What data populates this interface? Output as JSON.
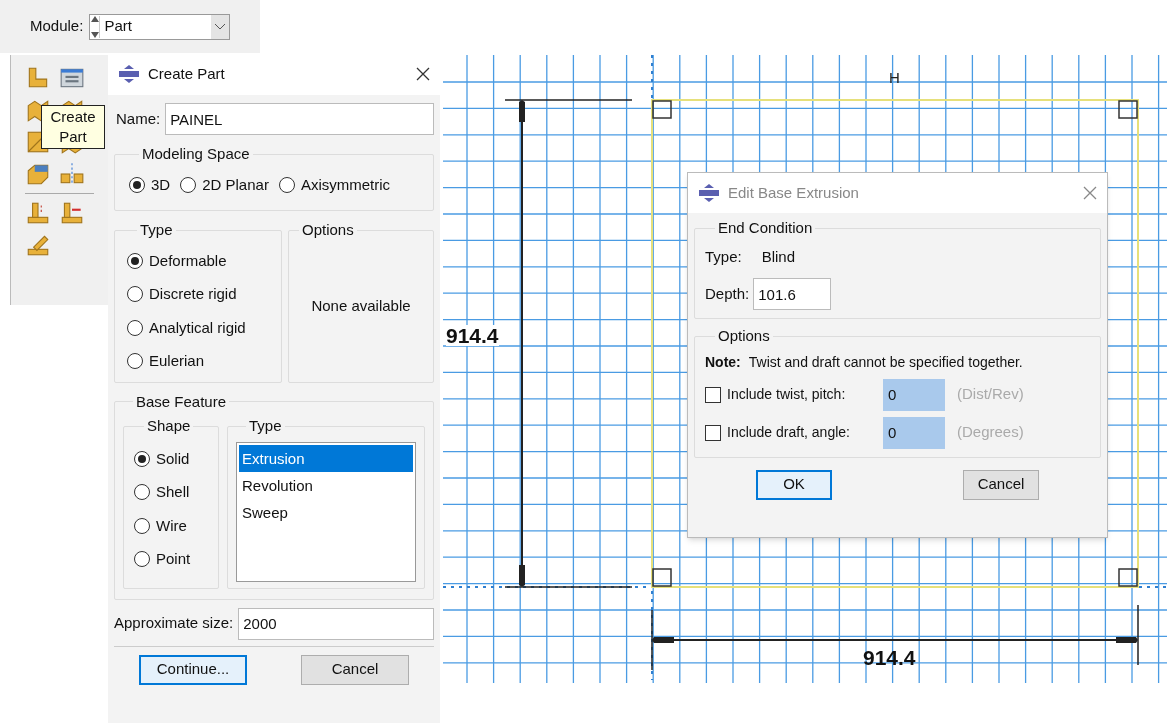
{
  "module_bar": {
    "label": "Module:",
    "value": "Part"
  },
  "toolbar": {
    "tooltip": "Create Part"
  },
  "create_part": {
    "title": "Create Part",
    "name_label": "Name:",
    "name_value": "PAINEL",
    "modeling_space": {
      "title": "Modeling Space",
      "options": [
        {
          "label": "3D",
          "selected": true
        },
        {
          "label": "2D Planar",
          "selected": false
        },
        {
          "label": "Axisymmetric",
          "selected": false
        }
      ]
    },
    "type": {
      "title": "Type",
      "options": [
        {
          "label": "Deformable",
          "selected": true
        },
        {
          "label": "Discrete rigid",
          "selected": false
        },
        {
          "label": "Analytical rigid",
          "selected": false
        },
        {
          "label": "Eulerian",
          "selected": false
        }
      ]
    },
    "options": {
      "title": "Options",
      "text": "None available"
    },
    "base_feature": {
      "title": "Base Feature",
      "shape": {
        "title": "Shape",
        "options": [
          {
            "label": "Solid",
            "selected": true
          },
          {
            "label": "Shell",
            "selected": false
          },
          {
            "label": "Wire",
            "selected": false
          },
          {
            "label": "Point",
            "selected": false
          }
        ]
      },
      "type": {
        "title": "Type",
        "items": [
          {
            "label": "Extrusion",
            "selected": true
          },
          {
            "label": "Revolution",
            "selected": false
          },
          {
            "label": "Sweep",
            "selected": false
          }
        ]
      }
    },
    "approximate_size": {
      "label": "Approximate size:",
      "value": "2000"
    },
    "buttons": [
      {
        "label": "Continue...",
        "default": true
      },
      {
        "label": "Cancel",
        "default": false
      }
    ]
  },
  "edit_base_extrusion": {
    "title": "Edit Base Extrusion",
    "end_condition": {
      "title": "End Condition",
      "type_label": "Type:",
      "type_value": "Blind",
      "depth_label": "Depth:",
      "depth_value": "101.6"
    },
    "options": {
      "title": "Options",
      "note_label": "Note:",
      "note_text": "Twist and draft cannot be specified together.",
      "rows": [
        {
          "label": "Include twist, pitch:",
          "checked": false,
          "value": "0",
          "unit": "(Dist/Rev)"
        },
        {
          "label": "Include draft, angle:",
          "checked": false,
          "value": "0",
          "unit": "(Degrees)"
        }
      ]
    },
    "buttons": [
      {
        "label": "OK",
        "default": true
      },
      {
        "label": "Cancel",
        "default": false
      }
    ]
  },
  "canvas": {
    "vertical_dimension": "914.4",
    "horizontal_dimension": "914.4",
    "marker": "H"
  }
}
